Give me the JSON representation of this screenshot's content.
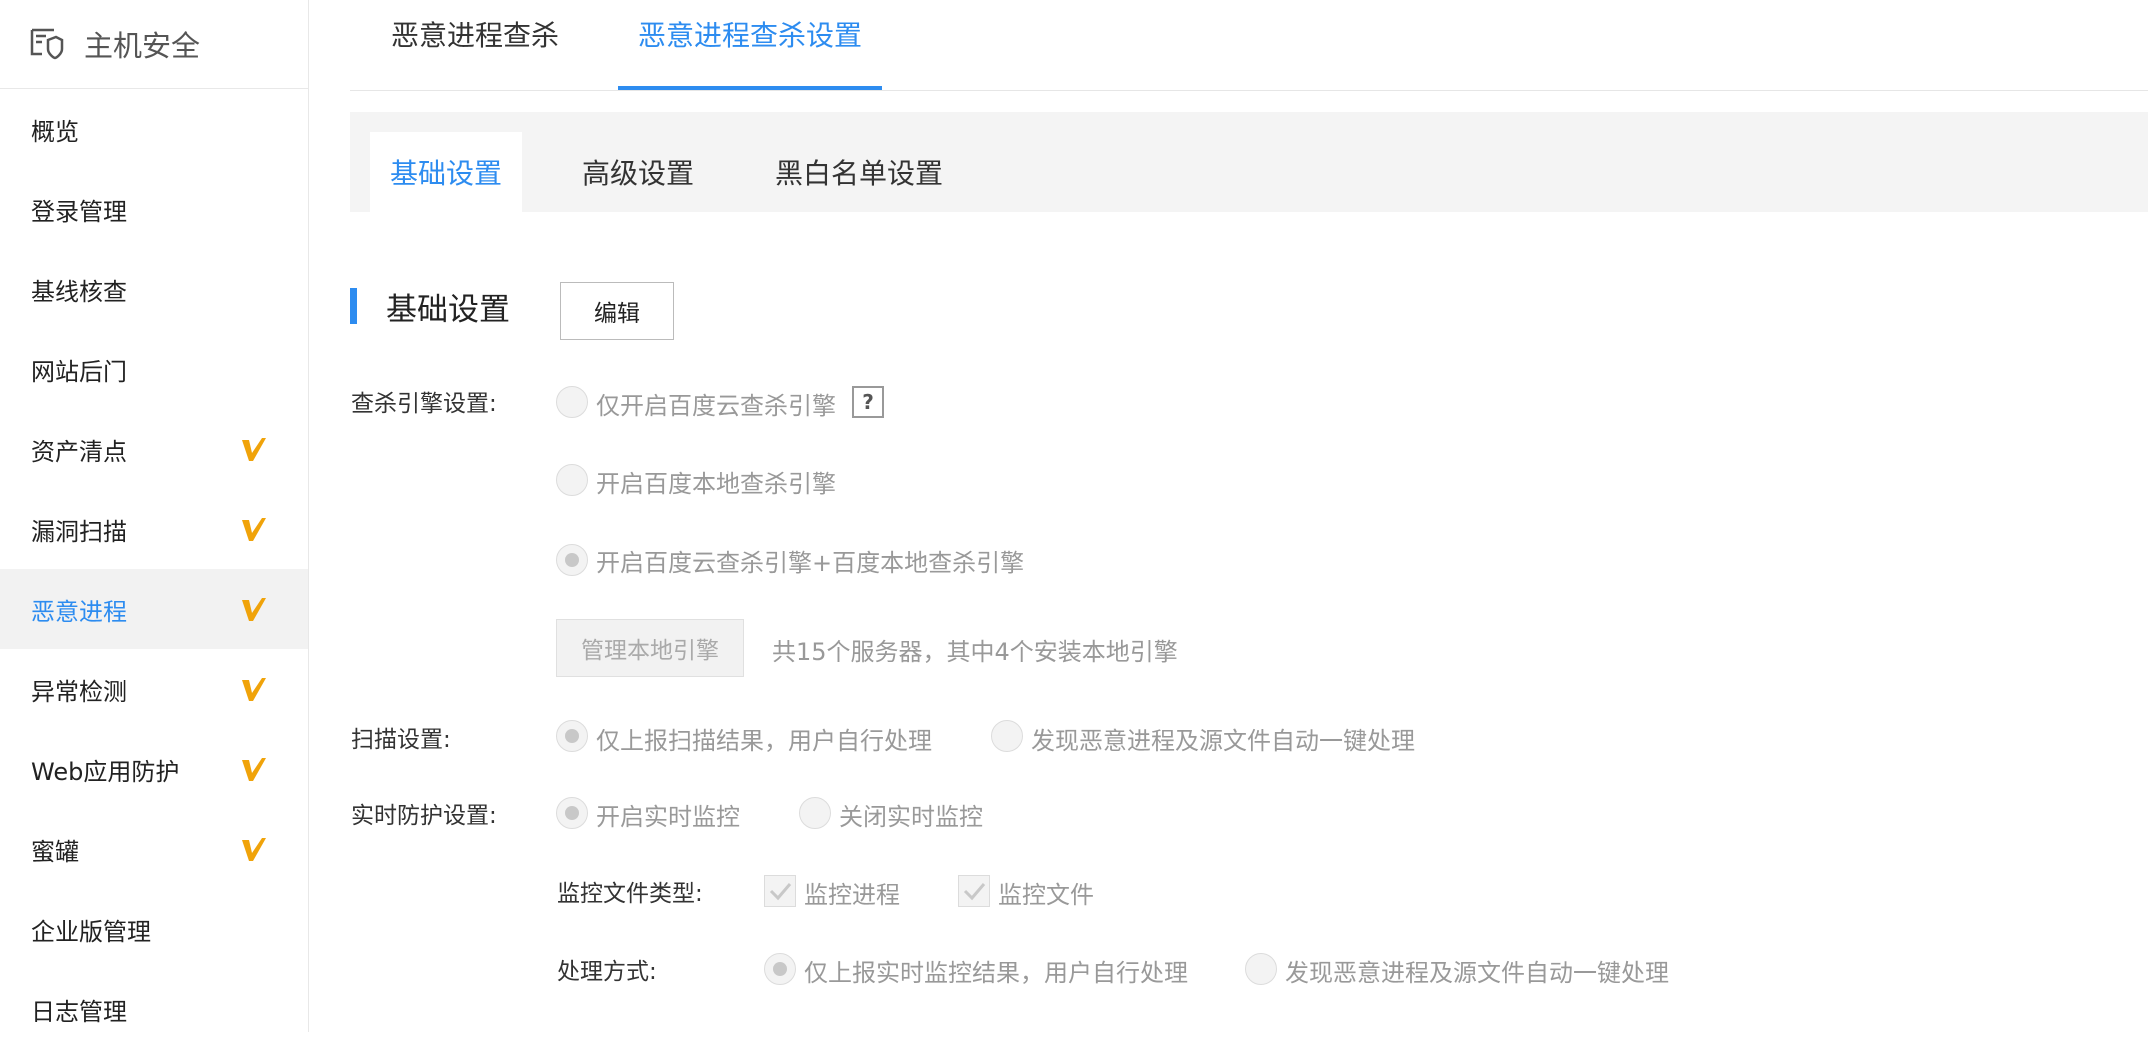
{
  "sidebar": {
    "title": "主机安全",
    "items": [
      {
        "label": "概览",
        "vip": false,
        "active": false
      },
      {
        "label": "登录管理",
        "vip": false,
        "active": false
      },
      {
        "label": "基线核查",
        "vip": false,
        "active": false
      },
      {
        "label": "网站后门",
        "vip": false,
        "active": false
      },
      {
        "label": "资产清点",
        "vip": true,
        "active": false
      },
      {
        "label": "漏洞扫描",
        "vip": true,
        "active": false
      },
      {
        "label": "恶意进程",
        "vip": true,
        "active": true
      },
      {
        "label": "异常检测",
        "vip": true,
        "active": false
      },
      {
        "label": "Web应用防护",
        "vip": true,
        "active": false
      },
      {
        "label": "蜜罐",
        "vip": true,
        "active": false
      },
      {
        "label": "企业版管理",
        "vip": false,
        "active": false
      },
      {
        "label": "日志管理",
        "vip": false,
        "active": false
      }
    ]
  },
  "top_tabs": [
    {
      "label": "恶意进程查杀",
      "active": false
    },
    {
      "label": "恶意进程查杀设置",
      "active": true
    }
  ],
  "sub_tabs": [
    {
      "label": "基础设置",
      "active": true
    },
    {
      "label": "高级设置",
      "active": false
    },
    {
      "label": "黑白名单设置",
      "active": false
    }
  ],
  "section": {
    "title": "基础设置",
    "edit_label": "编辑"
  },
  "engine": {
    "label": "查杀引擎设置:",
    "options": [
      {
        "label": "仅开启百度云查杀引擎",
        "checked": false
      },
      {
        "label": "开启百度本地查杀引擎",
        "checked": false
      },
      {
        "label": "开启百度云查杀引擎+百度本地查杀引擎",
        "checked": true
      }
    ],
    "help": "?",
    "manage_label": "管理本地引擎",
    "server_info": "共15个服务器，其中4个安装本地引擎"
  },
  "scan": {
    "label": "扫描设置:",
    "options": [
      {
        "label": "仅上报扫描结果，用户自行处理",
        "checked": true
      },
      {
        "label": "发现恶意进程及源文件自动一键处理",
        "checked": false
      }
    ]
  },
  "realtime": {
    "label": "实时防护设置:",
    "options": [
      {
        "label": "开启实时监控",
        "checked": true
      },
      {
        "label": "关闭实时监控",
        "checked": false
      }
    ],
    "filetype_label": "监控文件类型:",
    "filetypes": [
      {
        "label": "监控进程",
        "checked": true
      },
      {
        "label": "监控文件",
        "checked": true
      }
    ],
    "handling_label": "处理方式:",
    "handling": [
      {
        "label": "仅上报实时监控结果，用户自行处理",
        "checked": true
      },
      {
        "label": "发现恶意进程及源文件自动一键处理",
        "checked": false
      }
    ]
  },
  "colors": {
    "accent": "#2d8cf0",
    "vip": "#f0a30a"
  }
}
